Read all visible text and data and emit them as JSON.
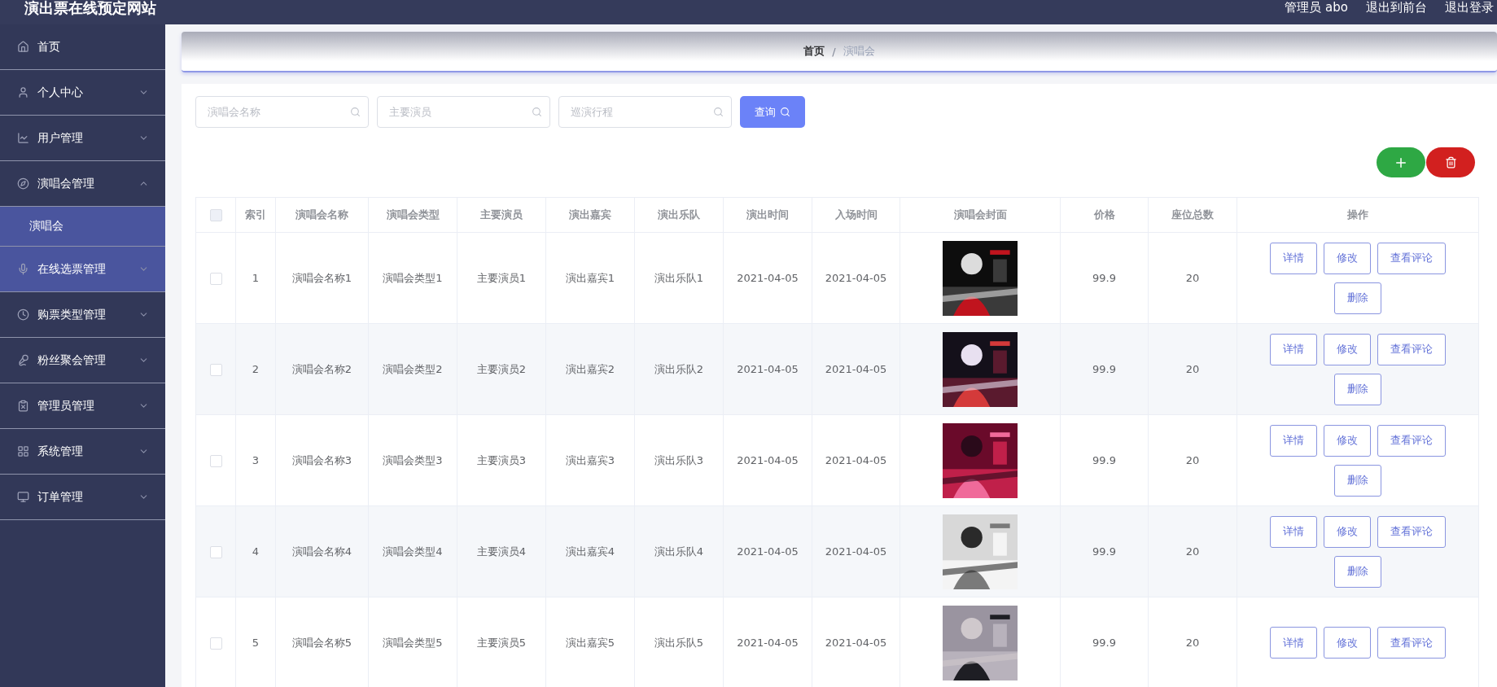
{
  "header": {
    "title": "演出票在线预定网站",
    "user": "管理员 abo",
    "links": [
      "退出到前台",
      "退出登录"
    ]
  },
  "sidebar": {
    "items": [
      {
        "label": "首页",
        "kind": "link",
        "highlighted": false
      },
      {
        "label": "个人中心",
        "kind": "menu",
        "expanded": false,
        "highlighted": false
      },
      {
        "label": "用户管理",
        "kind": "menu",
        "expanded": false,
        "highlighted": false
      },
      {
        "label": "演唱会管理",
        "kind": "menu",
        "expanded": true,
        "highlighted": false,
        "children": [
          {
            "label": "演唱会",
            "selected": true
          }
        ]
      },
      {
        "label": "在线选票管理",
        "kind": "menu",
        "expanded": false,
        "highlighted": true
      },
      {
        "label": "购票类型管理",
        "kind": "menu",
        "expanded": false,
        "highlighted": false
      },
      {
        "label": "粉丝聚会管理",
        "kind": "menu",
        "expanded": false,
        "highlighted": false
      },
      {
        "label": "管理员管理",
        "kind": "menu",
        "expanded": false,
        "highlighted": false
      },
      {
        "label": "系统管理",
        "kind": "menu",
        "expanded": false,
        "highlighted": false
      },
      {
        "label": "订单管理",
        "kind": "menu",
        "expanded": false,
        "highlighted": false
      }
    ]
  },
  "breadcrumb": {
    "items": [
      "首页",
      "演唱会"
    ],
    "separator": "/"
  },
  "search": {
    "fields": [
      {
        "placeholder": "演唱会名称"
      },
      {
        "placeholder": "主要演员"
      },
      {
        "placeholder": "巡演行程"
      }
    ],
    "button": "查询"
  },
  "table": {
    "header_checked": false,
    "columns": [
      "索引",
      "演唱会名称",
      "演唱会类型",
      "主要演员",
      "演出嘉宾",
      "演出乐队",
      "演出时间",
      "入场时间",
      "演唱会封面",
      "价格",
      "座位总数",
      "操作"
    ],
    "rows": [
      {
        "checked": false,
        "index": "1",
        "name": "演唱会名称1",
        "type": "演唱会类型1",
        "performer": "主要演员1",
        "guest": "演出嘉宾1",
        "band": "演出乐队1",
        "show_time": "2021-04-05",
        "entry_time": "2021-04-05",
        "cover": {
          "kind": "picture"
        },
        "price": "99.9",
        "seats": "20",
        "actions": [
          "详情",
          "修改",
          "查看评论",
          "删除"
        ]
      },
      {
        "checked": false,
        "index": "2",
        "name": "演唱会名称2",
        "type": "演唱会类型2",
        "performer": "主要演员2",
        "guest": "演出嘉宾2",
        "band": "演出乐队2",
        "show_time": "2021-04-05",
        "entry_time": "2021-04-05",
        "cover": {
          "kind": "picture"
        },
        "price": "99.9",
        "seats": "20",
        "actions": [
          "详情",
          "修改",
          "查看评论",
          "删除"
        ]
      },
      {
        "checked": false,
        "index": "3",
        "name": "演唱会名称3",
        "type": "演唱会类型3",
        "performer": "主要演员3",
        "guest": "演出嘉宾3",
        "band": "演出乐队3",
        "show_time": "2021-04-05",
        "entry_time": "2021-04-05",
        "cover": {
          "kind": "picture"
        },
        "price": "99.9",
        "seats": "20",
        "actions": [
          "详情",
          "修改",
          "查看评论",
          "删除"
        ]
      },
      {
        "checked": false,
        "index": "4",
        "name": "演唱会名称4",
        "type": "演唱会类型4",
        "performer": "主要演员4",
        "guest": "演出嘉宾4",
        "band": "演出乐队4",
        "show_time": "2021-04-05",
        "entry_time": "2021-04-05",
        "cover": {
          "kind": "picture"
        },
        "price": "99.9",
        "seats": "20",
        "actions": [
          "详情",
          "修改",
          "查看评论",
          "删除"
        ]
      },
      {
        "checked": false,
        "index": "5",
        "name": "演唱会名称5",
        "type": "演唱会类型5",
        "performer": "主要演员5",
        "guest": "演出嘉宾5",
        "band": "演出乐队5",
        "show_time": "2021-04-05",
        "entry_time": "2021-04-05",
        "cover": {
          "kind": "picture"
        },
        "price": "99.9",
        "seats": "20",
        "actions": [
          "详情",
          "修改",
          "查看评论"
        ]
      }
    ]
  }
}
